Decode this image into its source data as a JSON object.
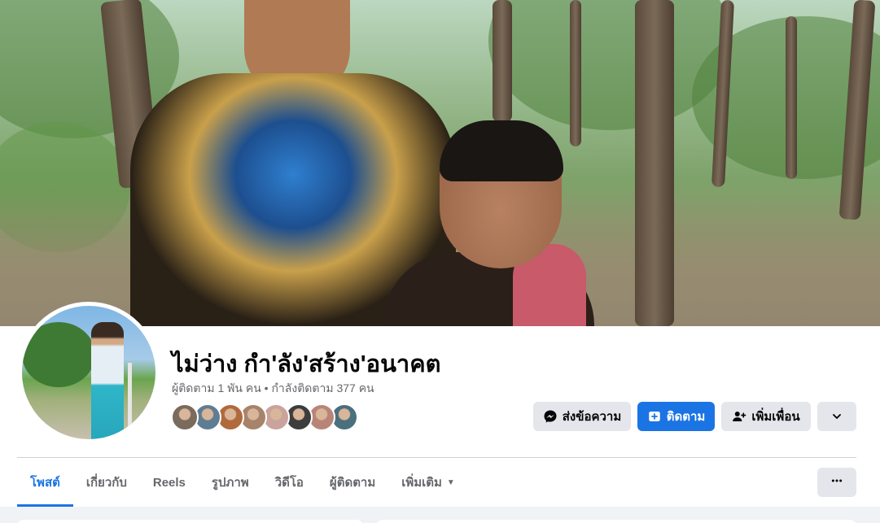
{
  "profile": {
    "name": "ไม่ว่าง กำ'ลัง'สร้าง'อนาคต",
    "stats": "ผู้ติดตาม 1 พัน คน • กำลังติดตาม 377 คน"
  },
  "friends": [
    {
      "color": "#7a6b5c"
    },
    {
      "color": "#5f7d92"
    },
    {
      "color": "#b06a3c"
    },
    {
      "color": "#a7836b"
    },
    {
      "color": "#c9a39c"
    },
    {
      "color": "#3d3d3d"
    },
    {
      "color": "#b98478"
    },
    {
      "color": "#4a6f7d"
    }
  ],
  "actions": {
    "message_label": "ส่งข้อความ",
    "follow_label": "ติดตาม",
    "add_friend_label": "เพิ่มเพื่อน"
  },
  "tabs": [
    {
      "label": "โพสต์",
      "active": true
    },
    {
      "label": "เกี่ยวกับ",
      "active": false
    },
    {
      "label": "Reels",
      "active": false
    },
    {
      "label": "รูปภาพ",
      "active": false
    },
    {
      "label": "วิดีโอ",
      "active": false
    },
    {
      "label": "ผู้ติดตาม",
      "active": false
    },
    {
      "label": "เพิ่มเติม",
      "active": false,
      "dropdown": true
    }
  ],
  "colors": {
    "accent": "#1b74e4",
    "secondary_button": "#e4e6eb",
    "text_secondary": "#65676b"
  },
  "icons": {
    "message": "messenger-icon",
    "follow": "follow-plus-icon",
    "add_friend": "add-person-icon",
    "more": "chevron-down-icon",
    "tabs_more": "ellipsis-icon"
  }
}
